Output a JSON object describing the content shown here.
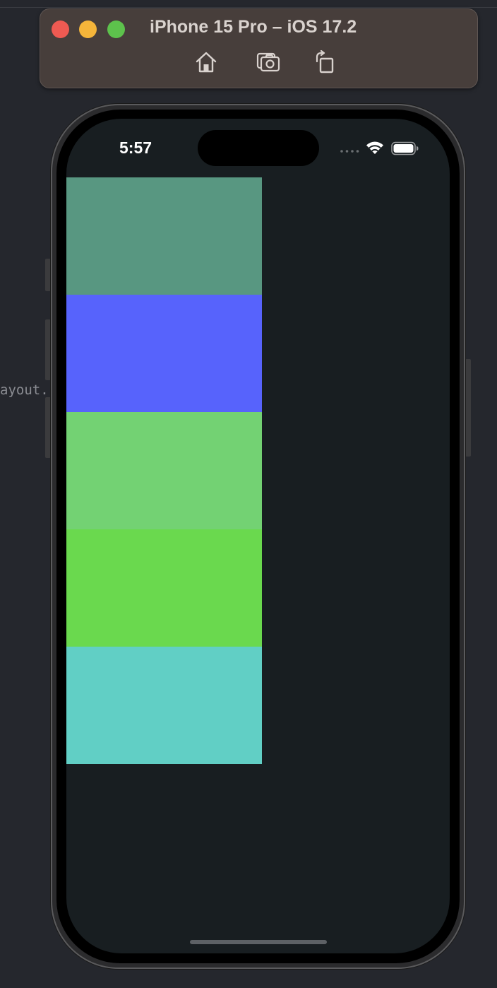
{
  "window": {
    "title": "iPhone 15 Pro – iOS 17.2",
    "toolbar": [
      {
        "name": "home-button",
        "icon": "home-icon"
      },
      {
        "name": "screenshot-button",
        "icon": "camera-icon"
      },
      {
        "name": "rotate-button",
        "icon": "rotate-icon"
      }
    ]
  },
  "background_code_text": "ayout.",
  "status_bar": {
    "time": "5:57",
    "icons": [
      "cellular-dots-icon",
      "wifi-icon",
      "battery-icon"
    ]
  },
  "color_blocks": [
    {
      "color": "#589781"
    },
    {
      "color": "#5763fc"
    },
    {
      "color": "#73d273"
    },
    {
      "color": "#6ad94e"
    },
    {
      "color": "#61cfc5"
    }
  ],
  "colors": {
    "screen_background": "#181e21",
    "titlebar": "#473e3b",
    "desktop": "#25272d"
  }
}
